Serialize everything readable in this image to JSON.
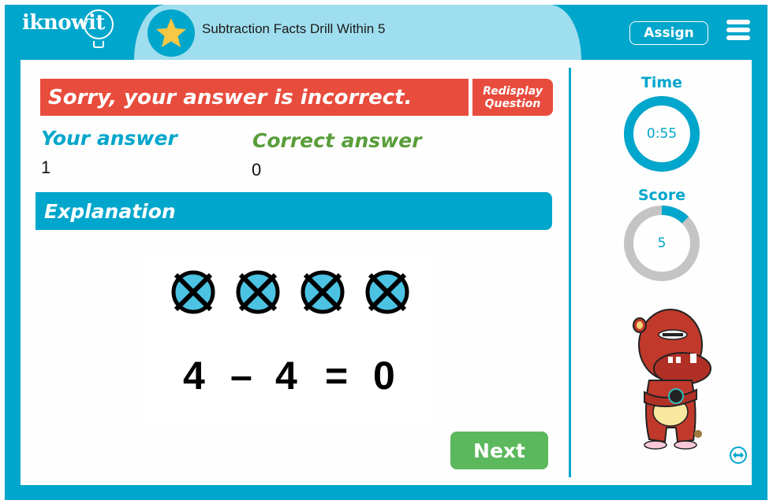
{
  "header": {
    "logo_text": "iknowit",
    "title": "Subtraction Facts Drill Within 5",
    "assign_label": "Assign",
    "star_icon": "star-icon",
    "menu_icon": "hamburger-menu-icon"
  },
  "feedback": {
    "message": "Sorry, your answer is incorrect.",
    "redisplay_line1": "Redisplay",
    "redisplay_line2": "Question"
  },
  "answers": {
    "your_label": "Your answer",
    "your_value": "1",
    "correct_label": "Correct answer",
    "correct_value": "0"
  },
  "explanation": {
    "title": "Explanation",
    "crossed_circles_count": 4,
    "equation": {
      "a": "4",
      "op": "–",
      "b": "4",
      "eq": "=",
      "result": "0"
    }
  },
  "next_label": "Next",
  "sidebar": {
    "time_label": "Time",
    "time_value": "0:55",
    "time_progress": 1.0,
    "score_label": "Score",
    "score_value": "5",
    "score_progress": 0.125
  },
  "colors": {
    "brand_blue": "#00a6cb",
    "light_blue": "#9fdeee",
    "error_red": "#e84c3d",
    "correct_green": "#5a9e3a",
    "next_green": "#5cb85c",
    "ring_gray": "#c4c4c4",
    "star_yellow": "#f7c843",
    "circle_fill": "#4cc3e3"
  }
}
